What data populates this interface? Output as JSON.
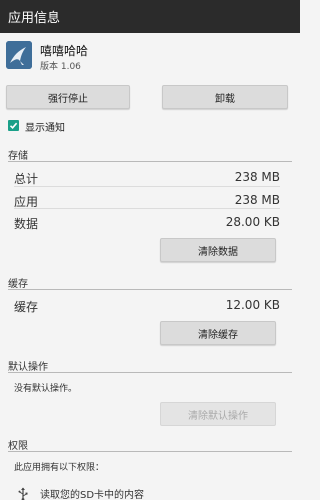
{
  "titlebar": {
    "title": "应用信息"
  },
  "app": {
    "name": "嘻嘻哈哈",
    "version": "版本 1.06"
  },
  "actions": {
    "force_stop": "强行停止",
    "uninstall": "卸载"
  },
  "notification": {
    "label": "显示通知",
    "checked": true
  },
  "storage": {
    "title": "存储",
    "rows": [
      {
        "label": "总计",
        "value": "238 MB"
      },
      {
        "label": "应用",
        "value": "238 MB"
      },
      {
        "label": "数据",
        "value": "28.00 KB"
      }
    ],
    "clear_data": "清除数据"
  },
  "cache": {
    "title": "缓存",
    "rows": [
      {
        "label": "缓存",
        "value": "12.00 KB"
      }
    ],
    "clear_cache": "清除缓存"
  },
  "defaults": {
    "title": "默认操作",
    "text": "没有默认操作。",
    "clear_defaults": "清除默认操作"
  },
  "permissions": {
    "title": "权限",
    "intro": "此应用拥有以下权限：",
    "items": [
      {
        "label": "读取您的SD卡中的内容",
        "icon": "usb-storage-icon"
      }
    ]
  },
  "colors": {
    "titlebar": "#2b2b2b",
    "checkbox": "#1aa089",
    "app_icon": "#3f6e99"
  }
}
